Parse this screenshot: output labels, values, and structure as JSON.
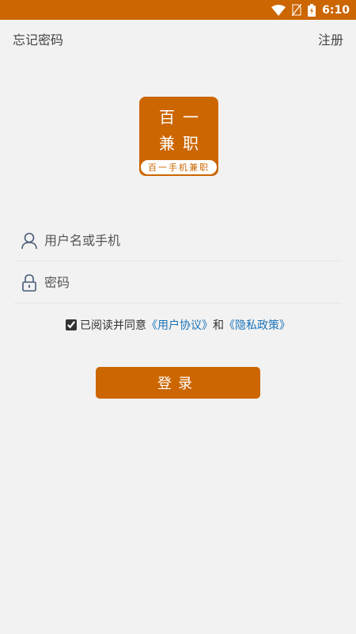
{
  "status_bar": {
    "time": "6:10",
    "icons": [
      "wifi-icon",
      "no-sim-icon",
      "battery-icon"
    ],
    "color": "#cc6600"
  },
  "header": {
    "forgot_password": "忘记密码",
    "register": "注册"
  },
  "logo": {
    "line1": "百一",
    "line2": "兼职",
    "tagline": "百一手机兼职",
    "color": "#cc6600"
  },
  "form": {
    "username_placeholder": "用户名或手机",
    "password_placeholder": "密码",
    "username_icon": "user-icon",
    "password_icon": "lock-icon"
  },
  "agreement": {
    "checked": true,
    "prefix": "已阅读并同意",
    "user_agreement": "《用户协议》",
    "and": "和",
    "privacy_policy": "《隐私政策》",
    "link_color": "#1a73b8"
  },
  "login_button": {
    "label": "登录"
  }
}
